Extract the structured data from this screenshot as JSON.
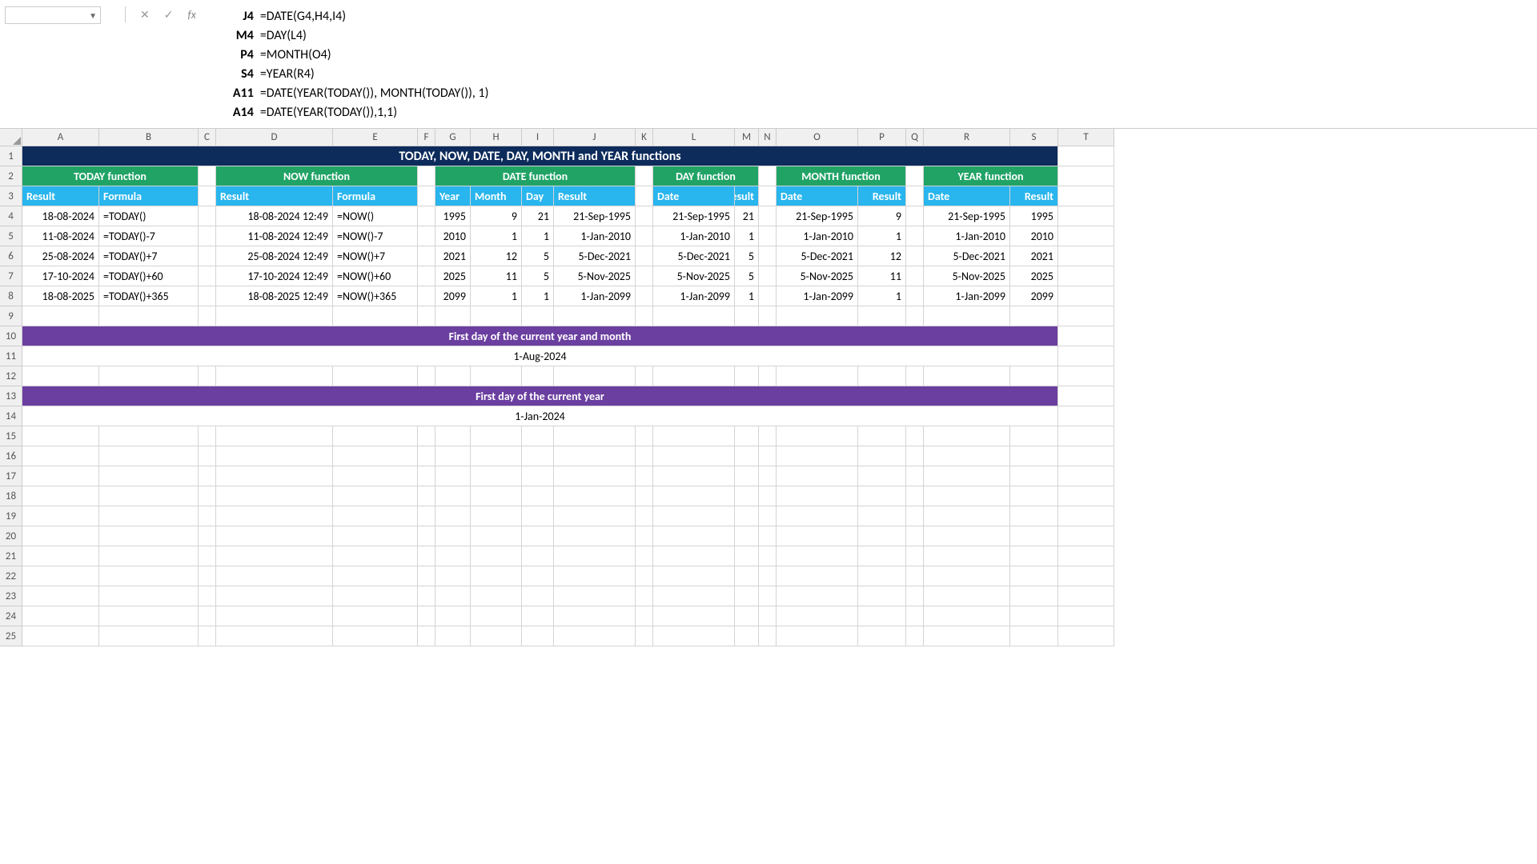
{
  "formulaBar": {
    "rows": [
      {
        "cell": "J4",
        "formula": "=DATE(G4,H4,I4)"
      },
      {
        "cell": "M4",
        "formula": "=DAY(L4)"
      },
      {
        "cell": "P4",
        "formula": "=MONTH(O4)"
      },
      {
        "cell": "S4",
        "formula": "=YEAR(R4)"
      },
      {
        "cell": "A11",
        "formula": "=DATE(YEAR(TODAY()), MONTH(TODAY()), 1)"
      },
      {
        "cell": "A14",
        "formula": "=DATE(YEAR(TODAY()),1,1)"
      }
    ]
  },
  "columns": [
    "A",
    "B",
    "C",
    "D",
    "E",
    "F",
    "G",
    "H",
    "I",
    "J",
    "K",
    "L",
    "M",
    "N",
    "O",
    "P",
    "Q",
    "R",
    "S",
    "T"
  ],
  "mainTitle": "TODAY, NOW, DATE, DAY, MONTH and YEAR functions",
  "sections": {
    "today": {
      "title": "TODAY function",
      "h1": "Result",
      "h2": "Formula"
    },
    "now": {
      "title": "NOW function",
      "h1": "Result",
      "h2": "Formula"
    },
    "date": {
      "title": "DATE function",
      "h1": "Year",
      "h2": "Month",
      "h3": "Day",
      "h4": "Result"
    },
    "day": {
      "title": "DAY function",
      "h1": "Date",
      "h2": "Result"
    },
    "month": {
      "title": "MONTH function",
      "h1": "Date",
      "h2": "Result"
    },
    "year": {
      "title": "YEAR function",
      "h1": "Date",
      "h2": "Result"
    }
  },
  "data": {
    "today": [
      {
        "r": "18-08-2024",
        "f": "=TODAY()"
      },
      {
        "r": "11-08-2024",
        "f": "=TODAY()-7"
      },
      {
        "r": "25-08-2024",
        "f": "=TODAY()+7"
      },
      {
        "r": "17-10-2024",
        "f": "=TODAY()+60"
      },
      {
        "r": "18-08-2025",
        "f": "=TODAY()+365"
      }
    ],
    "now": [
      {
        "r": "18-08-2024 12:49",
        "f": "=NOW()"
      },
      {
        "r": "11-08-2024 12:49",
        "f": "=NOW()-7"
      },
      {
        "r": "25-08-2024 12:49",
        "f": "=NOW()+7"
      },
      {
        "r": "17-10-2024 12:49",
        "f": "=NOW()+60"
      },
      {
        "r": "18-08-2025 12:49",
        "f": "=NOW()+365"
      }
    ],
    "date": [
      {
        "y": "1995",
        "m": "9",
        "d": "21",
        "r": "21-Sep-1995"
      },
      {
        "y": "2010",
        "m": "1",
        "d": "1",
        "r": "1-Jan-2010"
      },
      {
        "y": "2021",
        "m": "12",
        "d": "5",
        "r": "5-Dec-2021"
      },
      {
        "y": "2025",
        "m": "11",
        "d": "5",
        "r": "5-Nov-2025"
      },
      {
        "y": "2099",
        "m": "1",
        "d": "1",
        "r": "1-Jan-2099"
      }
    ],
    "day": [
      {
        "d": "21-Sep-1995",
        "r": "21"
      },
      {
        "d": "1-Jan-2010",
        "r": "1"
      },
      {
        "d": "5-Dec-2021",
        "r": "5"
      },
      {
        "d": "5-Nov-2025",
        "r": "5"
      },
      {
        "d": "1-Jan-2099",
        "r": "1"
      }
    ],
    "month": [
      {
        "d": "21-Sep-1995",
        "r": "9"
      },
      {
        "d": "1-Jan-2010",
        "r": "1"
      },
      {
        "d": "5-Dec-2021",
        "r": "12"
      },
      {
        "d": "5-Nov-2025",
        "r": "11"
      },
      {
        "d": "1-Jan-2099",
        "r": "1"
      }
    ],
    "year": [
      {
        "d": "21-Sep-1995",
        "r": "1995"
      },
      {
        "d": "1-Jan-2010",
        "r": "2010"
      },
      {
        "d": "5-Dec-2021",
        "r": "2021"
      },
      {
        "d": "5-Nov-2025",
        "r": "2025"
      },
      {
        "d": "1-Jan-2099",
        "r": "2099"
      }
    ]
  },
  "purple1": {
    "title": "First day of the current year and month",
    "value": "1-Aug-2024"
  },
  "purple2": {
    "title": "First day of the current year",
    "value": "1-Jan-2024"
  }
}
